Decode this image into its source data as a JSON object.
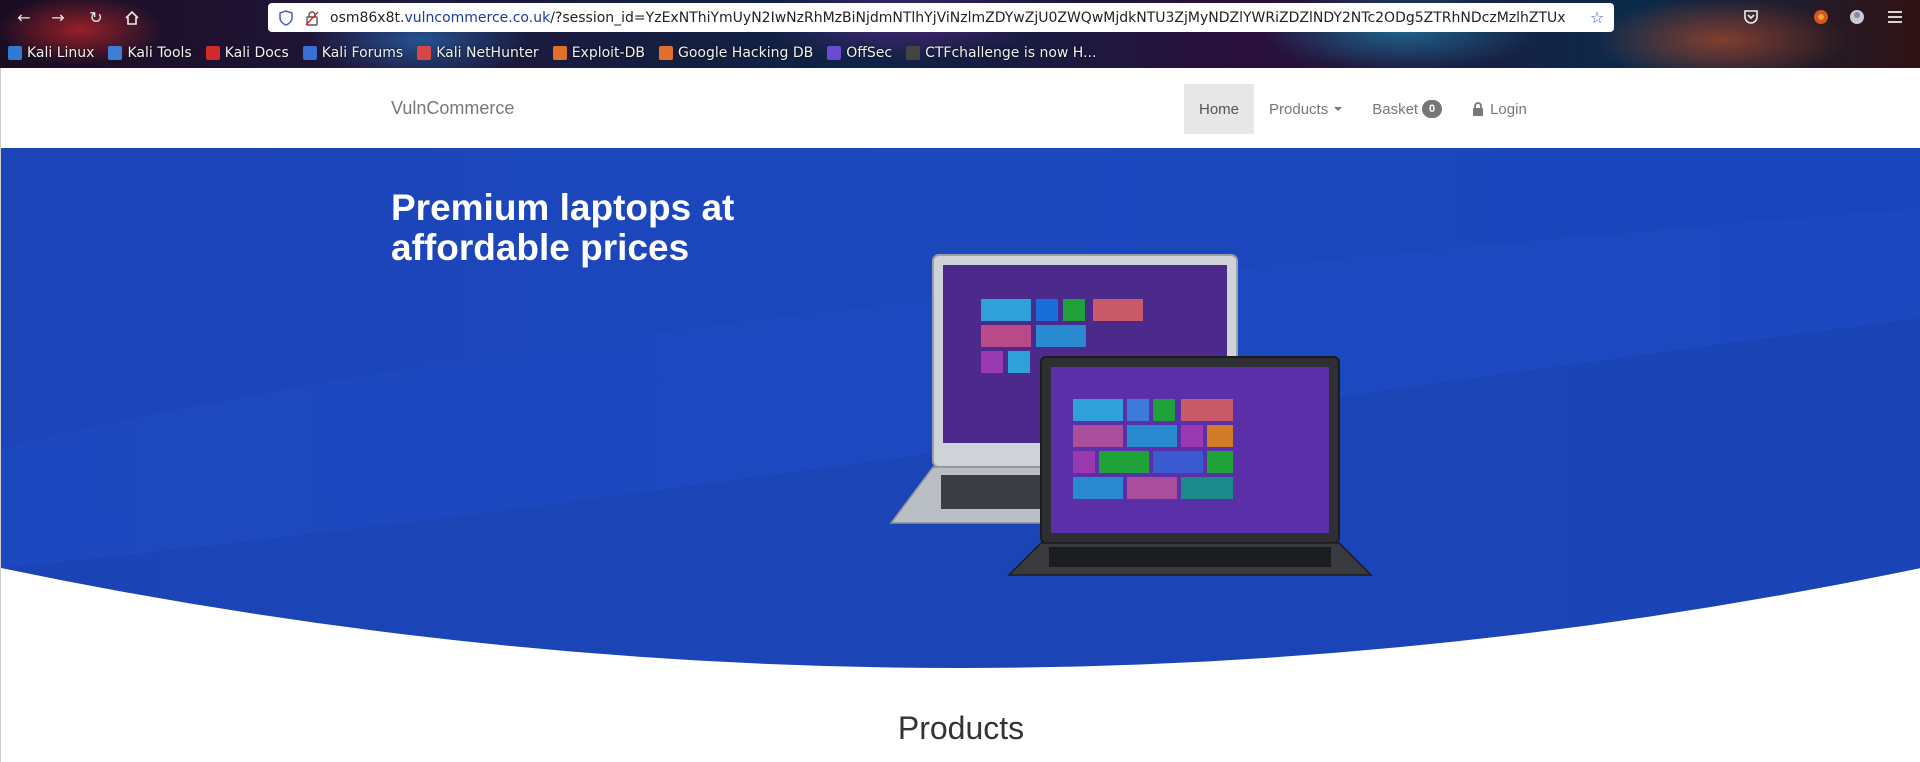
{
  "browser": {
    "url_host_prefix": "osm86x8t.",
    "url_host": "vulncommerce.co.uk",
    "url_path": "/?session_id=YzExNThiYmUyN2IwNzRhMzBiNjdmNTlhYjViNzlmZDYwZjU0ZWQwMjdkNTU3ZjMyNDZlYWRiZDZlNDY2NTc2ODg5ZTRhNDczMzlhZTUx",
    "bookmarks": [
      {
        "label": "Kali Linux",
        "color": "#2f7bd1"
      },
      {
        "label": "Kali Tools",
        "color": "#3b7fd6"
      },
      {
        "label": "Kali Docs",
        "color": "#d12a2a"
      },
      {
        "label": "Kali Forums",
        "color": "#3a6fd4"
      },
      {
        "label": "Kali NetHunter",
        "color": "#d64848"
      },
      {
        "label": "Exploit-DB",
        "color": "#e0702a"
      },
      {
        "label": "Google Hacking DB",
        "color": "#e0702a"
      },
      {
        "label": "OffSec",
        "color": "#6a4ad0"
      },
      {
        "label": "CTFchallenge is now H...",
        "color": "#444444"
      }
    ]
  },
  "site": {
    "brand": "VulnCommerce",
    "nav": {
      "home": "Home",
      "products": "Products",
      "basket": "Basket",
      "basket_count": "0",
      "login": "Login"
    },
    "hero": {
      "title": "Premium laptops at affordable prices",
      "bg_color": "#1d44b8"
    },
    "products_heading": "Products"
  }
}
